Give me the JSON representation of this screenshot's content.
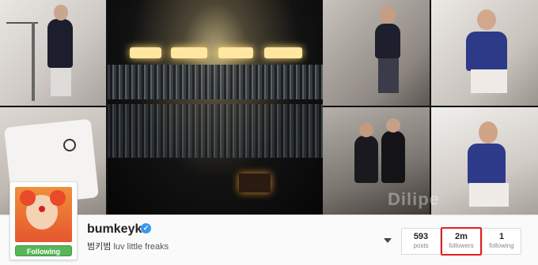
{
  "profile": {
    "username": "bumkeyk",
    "verified_icon": "check-icon",
    "bio_korean": "범키범",
    "bio_text": "luv little freaks",
    "follow_button_label": "Following"
  },
  "stats": {
    "posts_value": "593",
    "posts_label": "posts",
    "followers_value": "2m",
    "followers_label": "followers",
    "following_value": "1",
    "following_label": "following"
  },
  "colors": {
    "follow_button": "#5ab55a",
    "verified_badge": "#3897f0",
    "highlight_box": "#e02020"
  },
  "watermark": "Dilipe"
}
